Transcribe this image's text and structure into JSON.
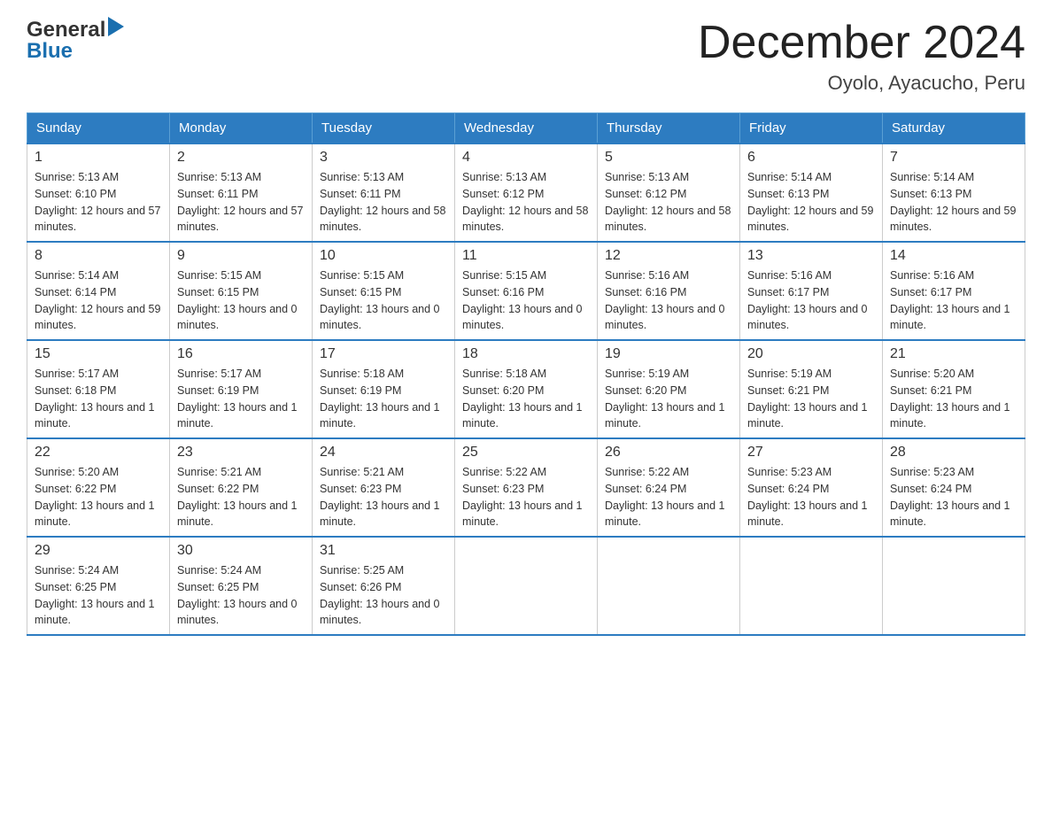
{
  "header": {
    "logo_general": "General",
    "logo_blue": "Blue",
    "title": "December 2024",
    "subtitle": "Oyolo, Ayacucho, Peru"
  },
  "days_of_week": [
    "Sunday",
    "Monday",
    "Tuesday",
    "Wednesday",
    "Thursday",
    "Friday",
    "Saturday"
  ],
  "weeks": [
    [
      {
        "day": "1",
        "sunrise": "5:13 AM",
        "sunset": "6:10 PM",
        "daylight": "12 hours and 57 minutes."
      },
      {
        "day": "2",
        "sunrise": "5:13 AM",
        "sunset": "6:11 PM",
        "daylight": "12 hours and 57 minutes."
      },
      {
        "day": "3",
        "sunrise": "5:13 AM",
        "sunset": "6:11 PM",
        "daylight": "12 hours and 58 minutes."
      },
      {
        "day": "4",
        "sunrise": "5:13 AM",
        "sunset": "6:12 PM",
        "daylight": "12 hours and 58 minutes."
      },
      {
        "day": "5",
        "sunrise": "5:13 AM",
        "sunset": "6:12 PM",
        "daylight": "12 hours and 58 minutes."
      },
      {
        "day": "6",
        "sunrise": "5:14 AM",
        "sunset": "6:13 PM",
        "daylight": "12 hours and 59 minutes."
      },
      {
        "day": "7",
        "sunrise": "5:14 AM",
        "sunset": "6:13 PM",
        "daylight": "12 hours and 59 minutes."
      }
    ],
    [
      {
        "day": "8",
        "sunrise": "5:14 AM",
        "sunset": "6:14 PM",
        "daylight": "12 hours and 59 minutes."
      },
      {
        "day": "9",
        "sunrise": "5:15 AM",
        "sunset": "6:15 PM",
        "daylight": "13 hours and 0 minutes."
      },
      {
        "day": "10",
        "sunrise": "5:15 AM",
        "sunset": "6:15 PM",
        "daylight": "13 hours and 0 minutes."
      },
      {
        "day": "11",
        "sunrise": "5:15 AM",
        "sunset": "6:16 PM",
        "daylight": "13 hours and 0 minutes."
      },
      {
        "day": "12",
        "sunrise": "5:16 AM",
        "sunset": "6:16 PM",
        "daylight": "13 hours and 0 minutes."
      },
      {
        "day": "13",
        "sunrise": "5:16 AM",
        "sunset": "6:17 PM",
        "daylight": "13 hours and 0 minutes."
      },
      {
        "day": "14",
        "sunrise": "5:16 AM",
        "sunset": "6:17 PM",
        "daylight": "13 hours and 1 minute."
      }
    ],
    [
      {
        "day": "15",
        "sunrise": "5:17 AM",
        "sunset": "6:18 PM",
        "daylight": "13 hours and 1 minute."
      },
      {
        "day": "16",
        "sunrise": "5:17 AM",
        "sunset": "6:19 PM",
        "daylight": "13 hours and 1 minute."
      },
      {
        "day": "17",
        "sunrise": "5:18 AM",
        "sunset": "6:19 PM",
        "daylight": "13 hours and 1 minute."
      },
      {
        "day": "18",
        "sunrise": "5:18 AM",
        "sunset": "6:20 PM",
        "daylight": "13 hours and 1 minute."
      },
      {
        "day": "19",
        "sunrise": "5:19 AM",
        "sunset": "6:20 PM",
        "daylight": "13 hours and 1 minute."
      },
      {
        "day": "20",
        "sunrise": "5:19 AM",
        "sunset": "6:21 PM",
        "daylight": "13 hours and 1 minute."
      },
      {
        "day": "21",
        "sunrise": "5:20 AM",
        "sunset": "6:21 PM",
        "daylight": "13 hours and 1 minute."
      }
    ],
    [
      {
        "day": "22",
        "sunrise": "5:20 AM",
        "sunset": "6:22 PM",
        "daylight": "13 hours and 1 minute."
      },
      {
        "day": "23",
        "sunrise": "5:21 AM",
        "sunset": "6:22 PM",
        "daylight": "13 hours and 1 minute."
      },
      {
        "day": "24",
        "sunrise": "5:21 AM",
        "sunset": "6:23 PM",
        "daylight": "13 hours and 1 minute."
      },
      {
        "day": "25",
        "sunrise": "5:22 AM",
        "sunset": "6:23 PM",
        "daylight": "13 hours and 1 minute."
      },
      {
        "day": "26",
        "sunrise": "5:22 AM",
        "sunset": "6:24 PM",
        "daylight": "13 hours and 1 minute."
      },
      {
        "day": "27",
        "sunrise": "5:23 AM",
        "sunset": "6:24 PM",
        "daylight": "13 hours and 1 minute."
      },
      {
        "day": "28",
        "sunrise": "5:23 AM",
        "sunset": "6:24 PM",
        "daylight": "13 hours and 1 minute."
      }
    ],
    [
      {
        "day": "29",
        "sunrise": "5:24 AM",
        "sunset": "6:25 PM",
        "daylight": "13 hours and 1 minute."
      },
      {
        "day": "30",
        "sunrise": "5:24 AM",
        "sunset": "6:25 PM",
        "daylight": "13 hours and 0 minutes."
      },
      {
        "day": "31",
        "sunrise": "5:25 AM",
        "sunset": "6:26 PM",
        "daylight": "13 hours and 0 minutes."
      },
      null,
      null,
      null,
      null
    ]
  ],
  "labels": {
    "sunrise": "Sunrise:",
    "sunset": "Sunset:",
    "daylight": "Daylight:"
  }
}
